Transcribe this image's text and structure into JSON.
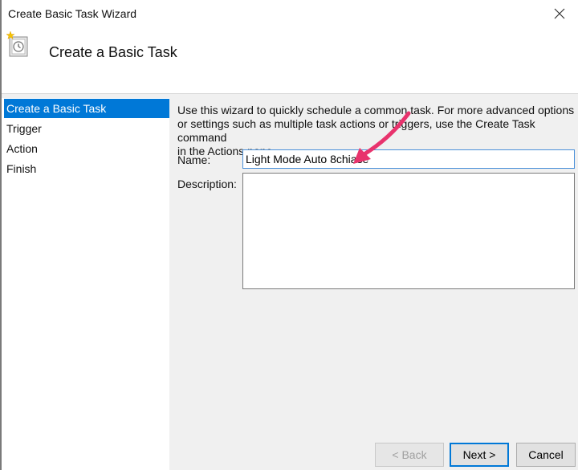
{
  "window": {
    "title": "Create Basic Task Wizard"
  },
  "header": {
    "title": "Create a Basic Task",
    "icon": "task-scheduler-clock-icon"
  },
  "steps": [
    {
      "label": "Create a Basic Task",
      "active": true
    },
    {
      "label": "Trigger",
      "active": false
    },
    {
      "label": "Action",
      "active": false
    },
    {
      "label": "Finish",
      "active": false
    }
  ],
  "content": {
    "intro_line1": "Use this wizard to quickly schedule a common task.  For more advanced options",
    "intro_line2": "or settings such as multiple task actions or triggers, use the Create Task command",
    "intro_line3": "in the Actions pane.",
    "name_label": "Name:",
    "name_value": "Light Mode Auto 8chiase",
    "description_label": "Description:",
    "description_value": ""
  },
  "annotation": {
    "arrow_color": "#e8336d"
  },
  "buttons": {
    "back": "< Back",
    "next": "Next >",
    "cancel": "Cancel"
  },
  "colors": {
    "accent": "#0078d7"
  }
}
